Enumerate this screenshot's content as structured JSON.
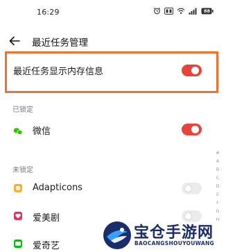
{
  "status_bar": {
    "time": "16:29",
    "battery": "88"
  },
  "header": {
    "title": "最近任务管理",
    "back_icon": "arrow-left-icon"
  },
  "settings": {
    "show_memory_info": {
      "label": "最近任务显示内存信息",
      "enabled": true
    }
  },
  "sections": {
    "locked": {
      "header": "已锁定",
      "apps": [
        {
          "name": "微信",
          "icon": "wechat-icon",
          "locked": true
        }
      ]
    },
    "unlocked": {
      "header": "未锁定",
      "apps": [
        {
          "name": "Adapticons",
          "icon": "adapticons-icon",
          "locked": false
        },
        {
          "name": "爱美剧",
          "icon": "aimeiju-icon",
          "locked": false
        },
        {
          "name": "爱奇艺",
          "icon": "iqiyi-icon",
          "locked": false
        }
      ]
    }
  },
  "alpha_index": [
    "#",
    "A",
    "B",
    "C",
    "D",
    "E",
    "F",
    "G",
    "H"
  ],
  "watermark": {
    "title": "宝仓手游网",
    "subtitle": "BAOCANGSHOUYOUWANG"
  },
  "colors": {
    "toggle_on": "#e8433a",
    "toggle_off": "#ebebeb",
    "highlight": "#f07030",
    "wechat": "#2dc100",
    "adapticons": "#f2b233",
    "aimeiju": "#d9365f",
    "iqiyi": "#00be06",
    "watermark": "#1b2c6b"
  }
}
